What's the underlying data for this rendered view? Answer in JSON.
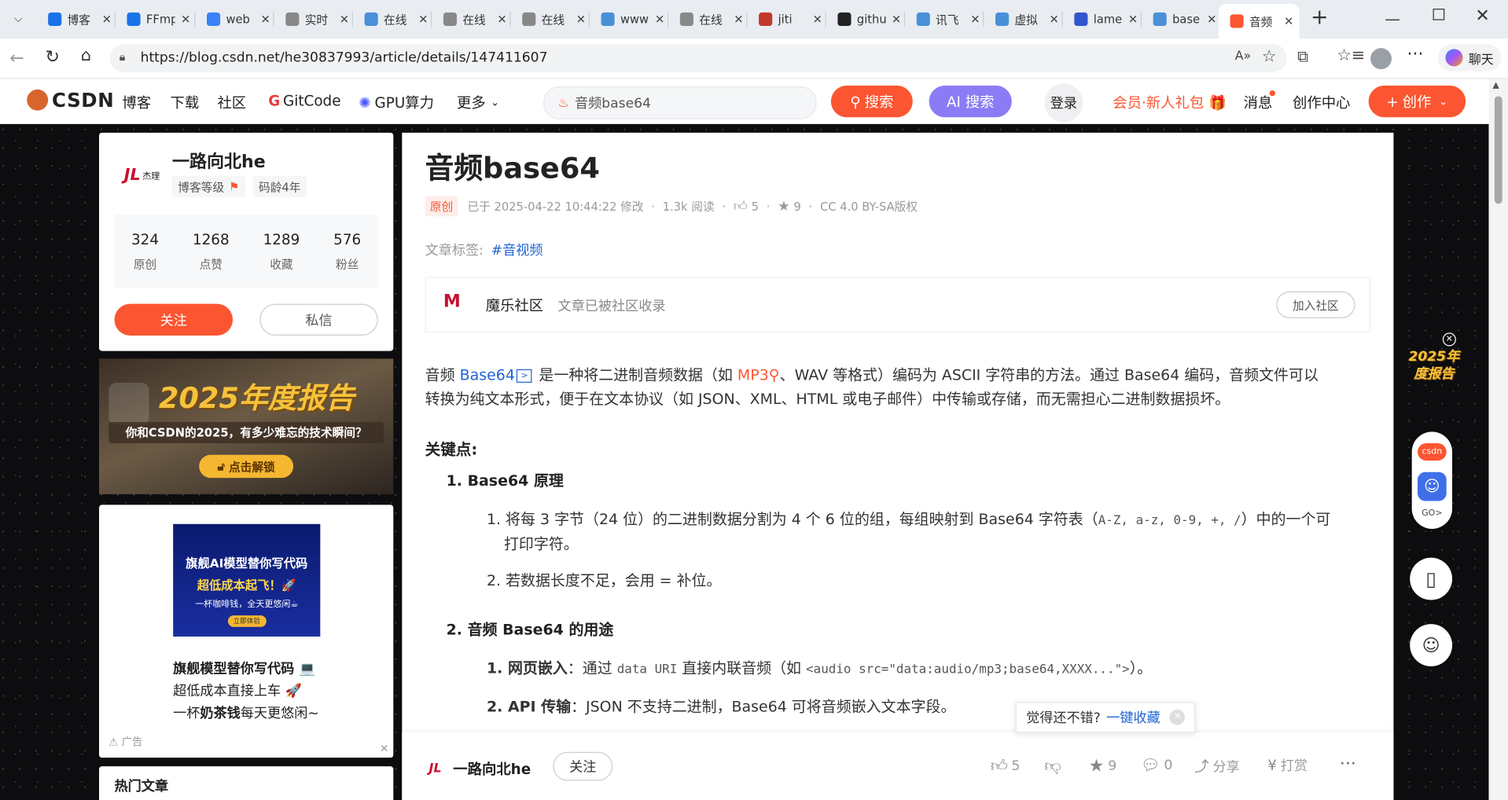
{
  "browser": {
    "tabs": [
      {
        "label": "博客",
        "color": "#1a73e8"
      },
      {
        "label": "FFmpeg",
        "color": "#1a73e8"
      },
      {
        "label": "web",
        "color": "#3b82f6"
      },
      {
        "label": "实时",
        "color": "#888888"
      },
      {
        "label": "在线",
        "color": "#4a90d9"
      },
      {
        "label": "在线",
        "color": "#888888"
      },
      {
        "label": "在线",
        "color": "#888888"
      },
      {
        "label": "www",
        "color": "#4a90d9"
      },
      {
        "label": "在线",
        "color": "#888888"
      },
      {
        "label": "jiti",
        "color": "#c0392b"
      },
      {
        "label": "github",
        "color": "#222222"
      },
      {
        "label": "讯飞",
        "color": "#4a90d9"
      },
      {
        "label": "虚拟",
        "color": "#4a90d9"
      },
      {
        "label": "lame",
        "color": "#3355cc"
      },
      {
        "label": "base",
        "color": "#4a90d9"
      },
      {
        "label": "音频",
        "color": "#fc5531"
      }
    ],
    "url": "https://blog.csdn.net/he30837993/article/details/147411607",
    "chat_label": "聊天"
  },
  "header": {
    "logo": "CSDN",
    "nav": [
      "博客",
      "下载",
      "社区",
      "GitCode",
      "GPU算力",
      "更多"
    ],
    "search_value": "音频base64",
    "search_btn": "搜索",
    "ai_search_btn": "AI 搜索",
    "login": "登录",
    "vip": "会员·新人礼包",
    "messages": "消息",
    "creator_center": "创作中心",
    "create_btn": "创作"
  },
  "author": {
    "name": "一路向北he",
    "level_label": "博客等级",
    "age": "码龄4年",
    "logo_text": "杰理",
    "stats": [
      {
        "num": "324",
        "label": "原创"
      },
      {
        "num": "1268",
        "label": "点赞"
      },
      {
        "num": "1289",
        "label": "收藏"
      },
      {
        "num": "576",
        "label": "粉丝"
      }
    ],
    "follow": "关注",
    "message": "私信"
  },
  "banner": {
    "title": "2025年度报告",
    "subtitle": "你和CSDN的2025，有多少难忘的技术瞬间？",
    "button": "点击解锁"
  },
  "ad": {
    "img_line1": "旗舰AI模型替你写代码",
    "img_line2": "超低成本起飞！🚀",
    "img_line3": "一杯咖啡钱，全天更悠闲☕",
    "img_btn": "立即体验",
    "line1": "旗舰模型替你写代码 💻",
    "line2": "超低成本直接上车 🚀",
    "line3_prefix": "一杯",
    "line3_bold": "奶茶钱",
    "line3_suffix": "每天更悠闲~",
    "label": "广告"
  },
  "hot": {
    "title": "热门文章"
  },
  "article": {
    "title": "音频base64",
    "badge": "原创",
    "modified": "已于 2025-04-22 10:44:22 修改",
    "reads": "1.3k 阅读",
    "likes": "5",
    "favs": "9",
    "license": "CC 4.0 BY-SA版权",
    "tags_label": "文章标签:",
    "tag": "#音视频",
    "community_name": "魔乐社区",
    "community_note": "文章已被社区收录",
    "join": "加入社区",
    "p1_a": "音频 ",
    "p1_link": "Base64",
    "p1_b": " 是一种将二进制音频数据（如 ",
    "p1_link2": "MP3",
    "p1_c": "、WAV 等格式）编码为 ASCII 字符串的方法。通过 Base64 编码，音频文件可以",
    "p1_d": "转换为纯文本形式，便于在文本协议（如 JSON、XML、HTML 或电子邮件）中传输或存储，而无需担心二进制数据损坏。",
    "h_key": "关键点:",
    "s1": "1.  Base64 原理",
    "s1_i1_a": "1.  将每 3 字节（24 位）的二进制数据分割为 4 个 6 位的组，每组映射到 Base64 字符表（",
    "s1_i1_code": "A-Z, a-z, 0-9, +, /",
    "s1_i1_b": "）中的一个可",
    "s1_i1_c": "打印字符。",
    "s1_i2": "2.  若数据长度不足，会用 = 补位。",
    "s2": "2.  音频 Base64 的用途",
    "s2_i1_bold": "1.  网页嵌入",
    "s2_i1_a": "：通过 ",
    "s2_i1_code1": "data URI",
    "s2_i1_b": " 直接内联音频（如 ",
    "s2_i1_code2": "<audio src=\"data:audio/mp3;base64,XXXX...\">",
    "s2_i1_c": "）。",
    "s2_i2_bold": "2.  API 传输",
    "s2_i2_a": "：JSON 不支持二进制，Base64 可将音频嵌入文本字段。"
  },
  "tooltip": {
    "text": "觉得还不错?",
    "link": "一键收藏"
  },
  "bottom": {
    "author": "一路向北he",
    "follow": "关注",
    "likes": "5",
    "favs": "9",
    "comments": "0",
    "share": "分享",
    "reward": "打赏"
  },
  "float": {
    "report": "2025年度报告",
    "go": "GO>",
    "csdn": "csdn"
  }
}
